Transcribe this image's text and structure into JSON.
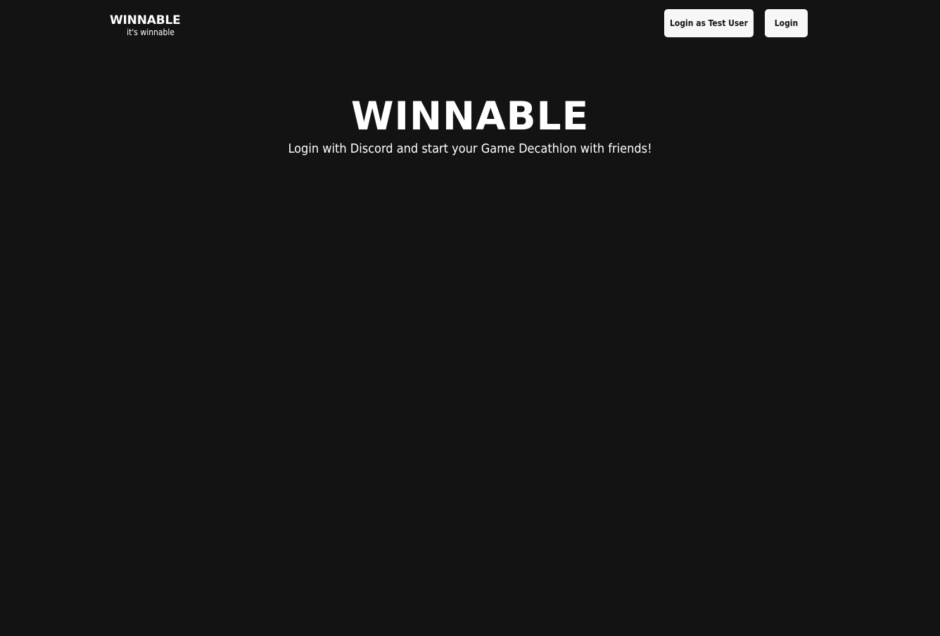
{
  "header": {
    "brand_name": "WINNABLE",
    "brand_tagline": "it's winnable",
    "test_user_button_label": "Login as Test User",
    "login_button_label": "Login"
  },
  "hero": {
    "title": "WINNABLE",
    "subtitle": "Login with Discord and start your Game Decathlon with friends!"
  },
  "colors": {
    "background": "#131313",
    "button_background": "#f7f7f7",
    "button_text": "#131313",
    "text": "#ffffff"
  }
}
